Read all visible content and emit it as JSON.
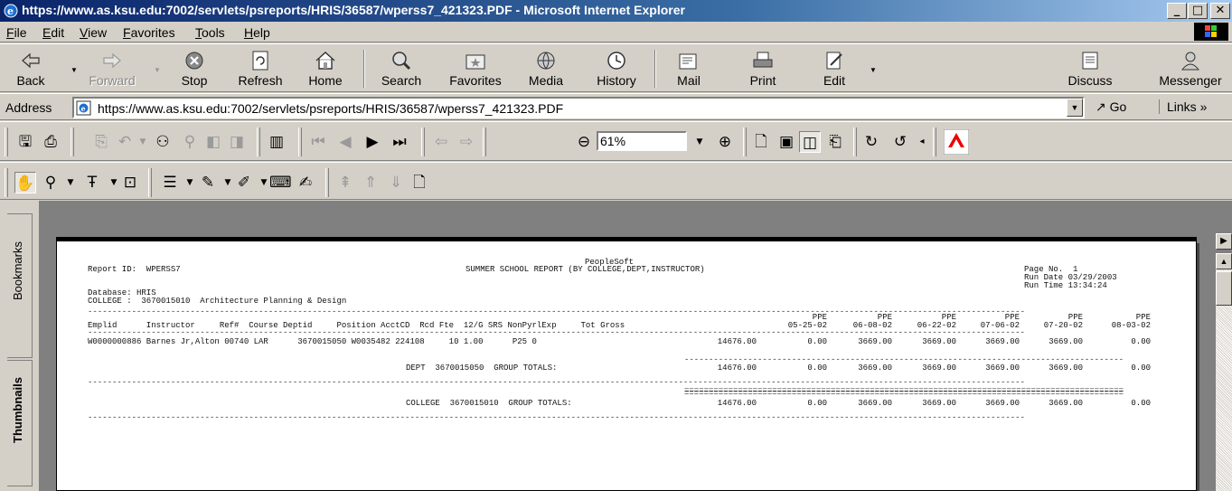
{
  "window": {
    "title": "https://www.as.ksu.edu:7002/servlets/psreports/HRIS/36587/wperss7_421323.PDF - Microsoft Internet Explorer",
    "min": "_",
    "max": "□",
    "close": "✕"
  },
  "menu": [
    "File",
    "Edit",
    "View",
    "Favorites",
    "Tools",
    "Help"
  ],
  "toolbar": {
    "back": "Back",
    "forward": "Forward",
    "stop": "Stop",
    "refresh": "Refresh",
    "home": "Home",
    "search": "Search",
    "favorites": "Favorites",
    "media": "Media",
    "history": "History",
    "mail": "Mail",
    "print": "Print",
    "edit": "Edit",
    "discuss": "Discuss",
    "messenger": "Messenger"
  },
  "address": {
    "label": "Address",
    "url": "https://www.as.ksu.edu:7002/servlets/psreports/HRIS/36587/wperss7_421323.PDF",
    "go": "Go",
    "links": "Links »"
  },
  "acrobat": {
    "zoom": "61%"
  },
  "side_tabs": {
    "bookmarks": "Bookmarks",
    "thumbnails": "Thumbnails"
  },
  "report": {
    "vendor": "PeopleSoft",
    "report_id": "Report ID:  WPERSS7",
    "title": "SUMMER SCHOOL REPORT (BY COLLEGE,DEPT,INSTRUCTOR)",
    "page_no": "Page No.  1",
    "run_date": "Run Date 03/29/2003",
    "run_time": "Run Time 13:34:24",
    "database": "Database: HRIS",
    "college": "COLLEGE :  3670015010  Architecture Planning & Design",
    "header_line": "Emplid      Instructor     Ref#  Course Deptid     Position AcctCD  Rcd Fte  12/G SRS NonPyrlExp     Tot Gross",
    "ppe_label": "PPE",
    "ppe_dates": [
      "05-25-02",
      "06-08-02",
      "06-22-02",
      "07-06-02",
      "07-20-02",
      "08-03-02"
    ],
    "detail_line": "W0000000886 Barnes Jr,Alton 00740 LAR      3670015050 W0035482 224108     10 1.00      P25 0",
    "tot_gross": "14676.00",
    "ppe_values": [
      "0.00",
      "3669.00",
      "3669.00",
      "3669.00",
      "3669.00",
      "0.00"
    ],
    "dept_total_label": "DEPT  3670015050  GROUP TOTALS:",
    "college_total_label": "COLLEGE  3670015010  GROUP TOTALS:"
  }
}
